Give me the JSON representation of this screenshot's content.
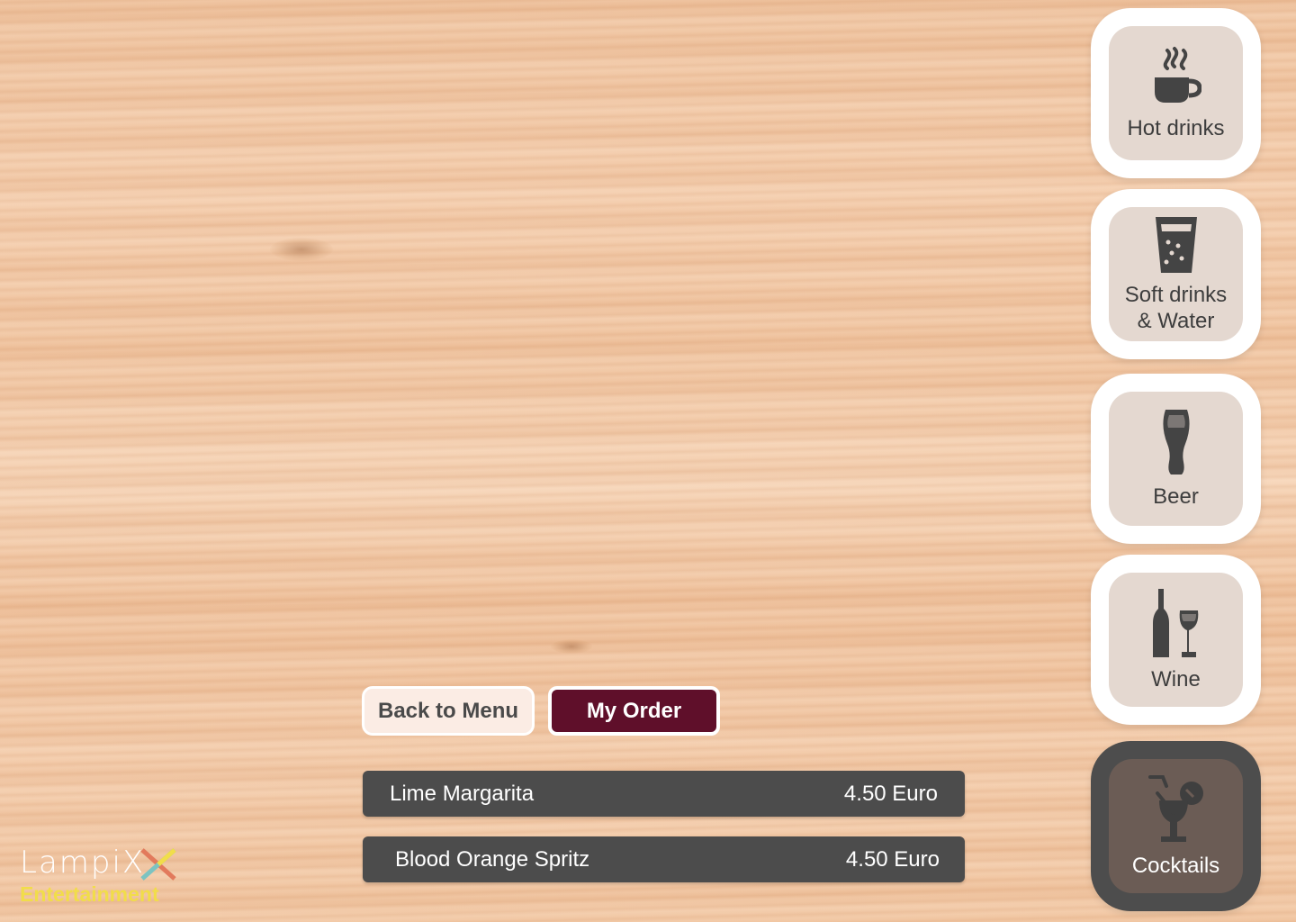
{
  "categories": [
    {
      "label": "Hot drinks",
      "icon": "coffee-cup-icon"
    },
    {
      "label": "Soft drinks & Water",
      "icon": "soda-glass-icon"
    },
    {
      "label": "Beer",
      "icon": "beer-glass-icon"
    },
    {
      "label": "Wine",
      "icon": "wine-bottle-glass-icon"
    },
    {
      "label": "Cocktails",
      "icon": "cocktail-glass-icon",
      "active": true
    }
  ],
  "actions": {
    "back_label": "Back to Menu",
    "order_label": "My Order"
  },
  "order_items": [
    {
      "name": "Lime Margarita",
      "price": "4.50 Euro"
    },
    {
      "name": "Blood Orange Spritz",
      "price": "4.50 Euro"
    }
  ],
  "branding": {
    "wordmark": "LampiX",
    "subtitle": "Entertainment"
  },
  "colors": {
    "order_button": "#5f0f2a",
    "row_background": "#4c4c4c",
    "active_category": "#4d4d4d",
    "brand_yellow": "#f1dd4a"
  }
}
